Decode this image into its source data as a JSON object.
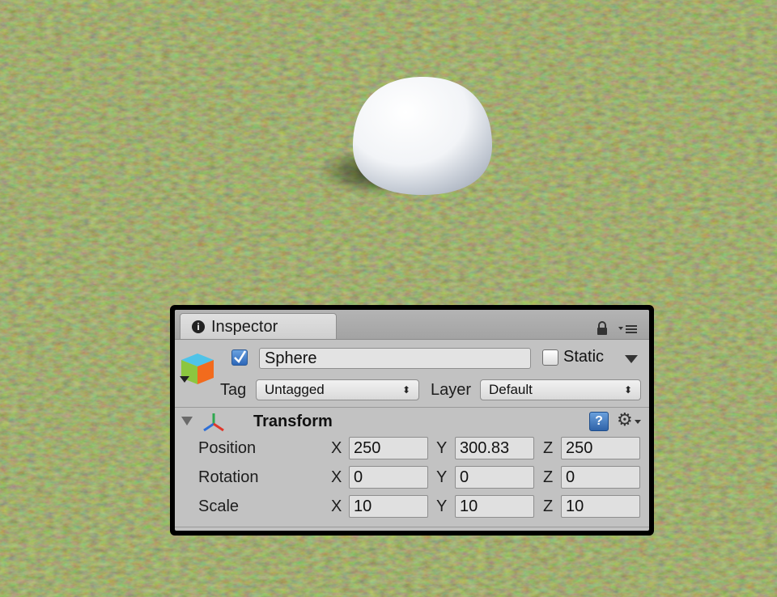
{
  "inspector": {
    "tab_label": "Inspector",
    "object_name": "Sphere",
    "active": true,
    "static_label": "Static",
    "static_checked": false,
    "tag_label": "Tag",
    "tag_value": "Untagged",
    "layer_label": "Layer",
    "layer_value": "Default"
  },
  "transform": {
    "title": "Transform",
    "help_icon": "?",
    "rows": [
      {
        "label": "Position",
        "x": "250",
        "y": "300.83",
        "z": "250"
      },
      {
        "label": "Rotation",
        "x": "0",
        "y": "0",
        "z": "0"
      },
      {
        "label": "Scale",
        "x": "10",
        "y": "10",
        "z": "10"
      }
    ],
    "axes": {
      "x": "X",
      "y": "Y",
      "z": "Z"
    }
  },
  "icons": {
    "tab": "info-icon",
    "lock": "lock-icon",
    "menu": "context-menu-icon",
    "gameobject": "gameobject-cube-icon",
    "transform": "transform-axes-icon",
    "help": "help-book-icon",
    "gear": "gear-icon"
  },
  "colors": {
    "panel_bg": "#c2c2c2",
    "grass": "#5f6e3c",
    "checkbox_blue": "#2c66b8"
  }
}
